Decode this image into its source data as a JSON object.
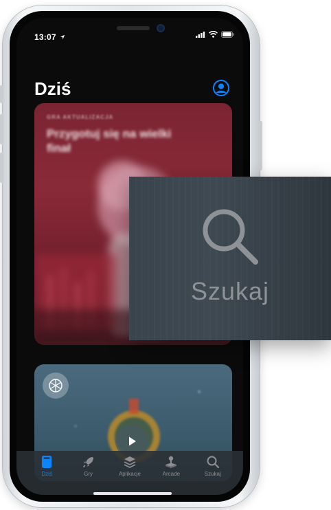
{
  "status_bar": {
    "time": "13:07"
  },
  "header": {
    "title": "Dziś"
  },
  "cards": {
    "featured": {
      "eyebrow": "GRA AKTUALIZACJA",
      "headline": "Przygotuj się na wielki finał"
    }
  },
  "tabs": [
    {
      "label": "Dziś",
      "icon": "today-icon",
      "active": true
    },
    {
      "label": "Gry",
      "icon": "rocket-icon",
      "active": false
    },
    {
      "label": "Aplikacje",
      "icon": "layers-icon",
      "active": false
    },
    {
      "label": "Arcade",
      "icon": "joystick-icon",
      "active": false
    },
    {
      "label": "Szukaj",
      "icon": "search-icon",
      "active": false
    }
  ],
  "zoom_callout": {
    "label": "Szukaj",
    "icon": "search-icon"
  },
  "colors": {
    "accent": "#0a84ff",
    "tab_inactive": "#8e8e93",
    "featured_card": "#7a2432",
    "arcade_card": "#4c6a7e"
  }
}
